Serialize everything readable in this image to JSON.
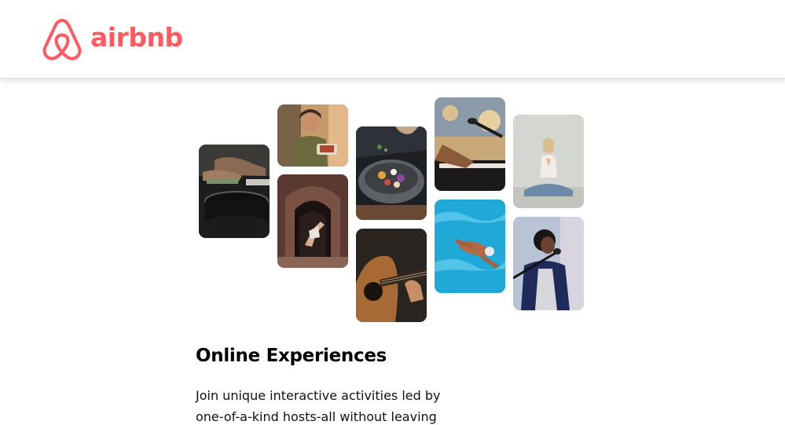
{
  "brand": {
    "name": "airbnb",
    "color": "#ff5a5f"
  },
  "gallery": {
    "photos": [
      {
        "id": "cooking-pans",
        "icon": "photo-cooking-class"
      },
      {
        "id": "woman-cooking",
        "icon": "photo-woman-holding-dish"
      },
      {
        "id": "dancer-doorway",
        "icon": "photo-dancer-in-doorway"
      },
      {
        "id": "food-bowl",
        "icon": "photo-food-bowl"
      },
      {
        "id": "acoustic-guitar",
        "icon": "photo-acoustic-guitar"
      },
      {
        "id": "keyboard-mic",
        "icon": "photo-piano-and-microphone"
      },
      {
        "id": "swimmer",
        "icon": "photo-swimmer-in-pool"
      },
      {
        "id": "yoga",
        "icon": "photo-yoga-meditation"
      },
      {
        "id": "singer",
        "icon": "photo-singer-with-microphone"
      }
    ]
  },
  "main": {
    "title": "Online Experiences",
    "description": "Join unique interactive activities led by one-of-a-kind hosts-all without leaving"
  }
}
